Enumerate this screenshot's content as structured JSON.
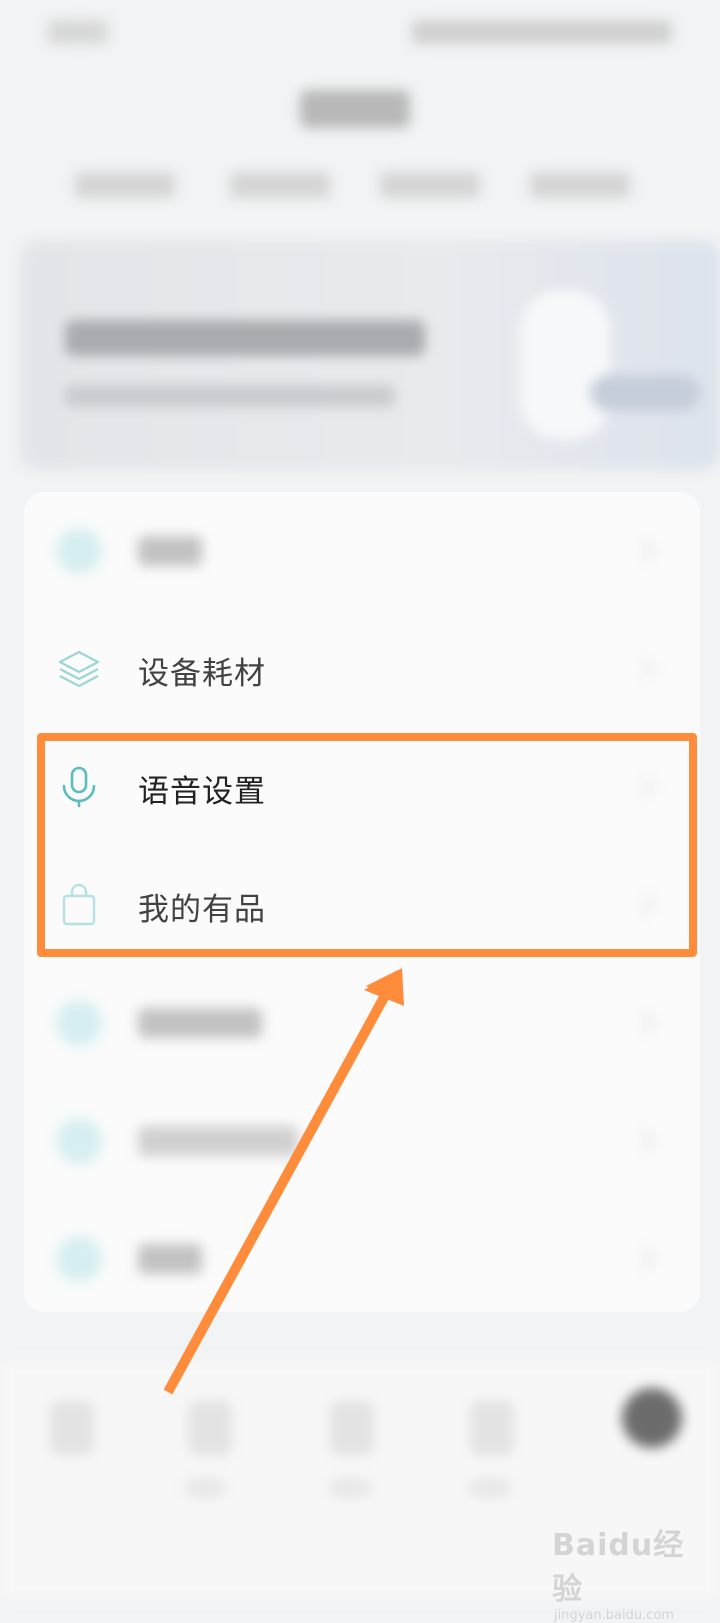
{
  "menu": {
    "items": [
      {
        "label": "设备耗材",
        "icon": "layers-icon"
      },
      {
        "label": "语音设置",
        "icon": "microphone-icon"
      },
      {
        "label": "我的有品",
        "icon": "shopping-bag-icon"
      }
    ]
  },
  "annotation": {
    "highlight_color": "#ff8c3a",
    "arrow_color": "#ff8c3a"
  },
  "watermark": {
    "main": "Baidu经验",
    "sub": "jingyan.baidu.com"
  },
  "colors": {
    "icon_teal": "#5bbdbf",
    "text": "#222222"
  }
}
